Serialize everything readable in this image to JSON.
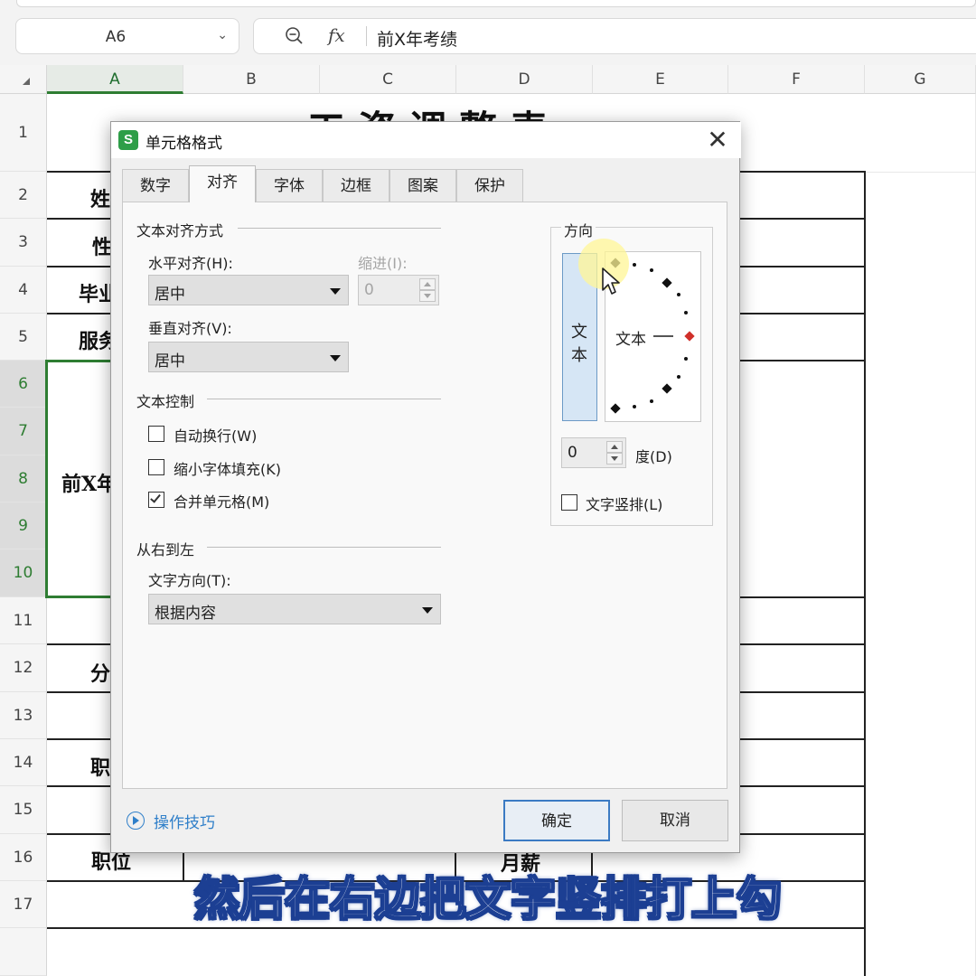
{
  "formula_bar": {
    "name_box": "A6",
    "fx_label": "fx",
    "formula_text": "前X年考绩"
  },
  "columns": [
    "A",
    "B",
    "C",
    "D",
    "E",
    "F",
    "G"
  ],
  "rows": [
    "1",
    "2",
    "3",
    "4",
    "5",
    "6",
    "7",
    "8",
    "9",
    "10",
    "11",
    "12",
    "13",
    "14",
    "15",
    "16",
    "17"
  ],
  "sheet": {
    "title_partial": "工资调整表",
    "cells": {
      "row2": "姓",
      "row3": "性",
      "row4": "毕业",
      "row5": "服务",
      "merged_a6": "前X年",
      "row12": "分",
      "row14": "职",
      "row16_a": "职位",
      "row16_d": "月薪"
    }
  },
  "dialog": {
    "title": "单元格格式",
    "app_icon_letter": "S",
    "close_glyph": "✕",
    "tabs": [
      "数字",
      "对齐",
      "字体",
      "边框",
      "图案",
      "保护"
    ],
    "active_tab": "对齐",
    "text_alignment": {
      "section": "文本对齐方式",
      "horizontal_label": "水平对齐(H):",
      "horizontal_value": "居中",
      "indent_label": "缩进(I):",
      "indent_value": "0",
      "vertical_label": "垂直对齐(V):",
      "vertical_value": "居中"
    },
    "text_control": {
      "section": "文本控制",
      "wrap_label": "自动换行(W)",
      "wrap_checked": false,
      "shrink_label": "缩小字体填充(K)",
      "shrink_checked": false,
      "merge_label": "合并单元格(M)",
      "merge_checked": true
    },
    "rtl": {
      "section": "从右到左",
      "direction_label": "文字方向(T):",
      "direction_value": "根据内容"
    },
    "orientation": {
      "section": "方向",
      "vertical_text_char1": "文",
      "vertical_text_char2": "本",
      "arc_text": "文本",
      "degree_value": "0",
      "degree_label": "度(D)",
      "vertical_label": "文字竖排(L)",
      "vertical_checked": false
    },
    "help_link": "操作技巧",
    "ok_label": "确定",
    "cancel_label": "取消"
  },
  "caption": "然后在右边把文字竖排打上勾",
  "colors": {
    "selection_green": "#2e7d32",
    "accent_blue": "#3b7ac3",
    "caption_stroke": "#1c3f93"
  }
}
